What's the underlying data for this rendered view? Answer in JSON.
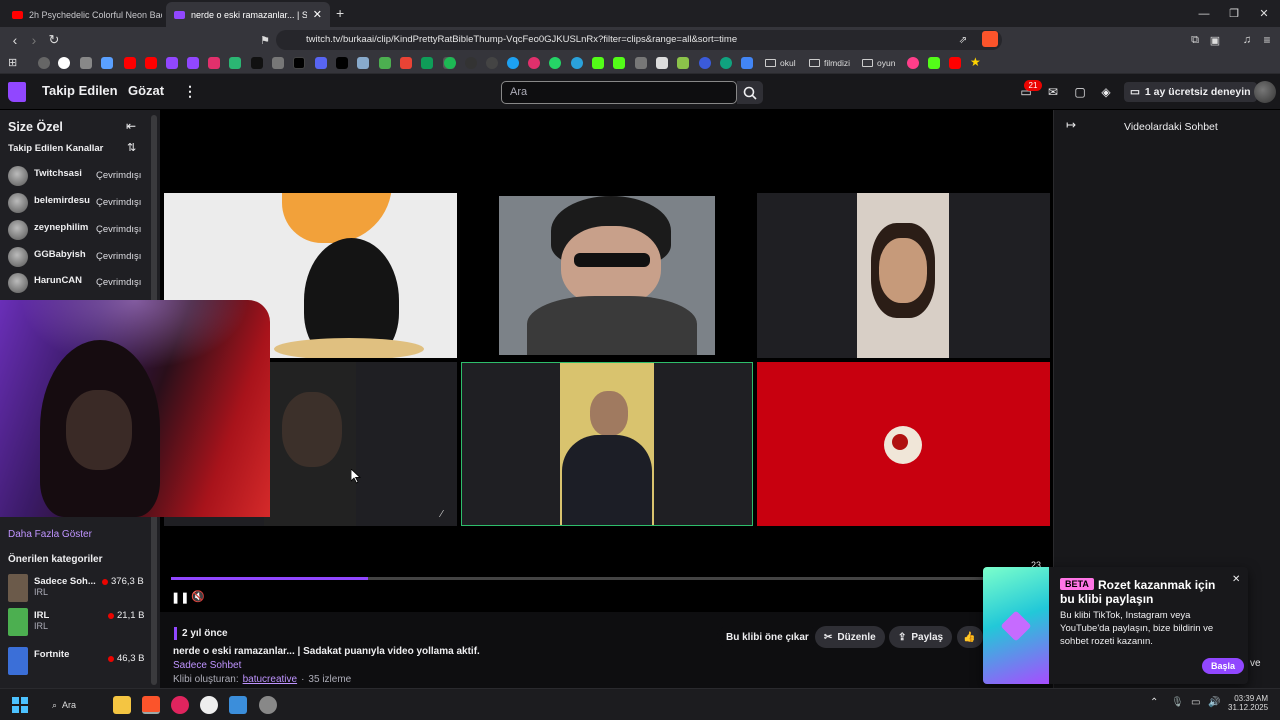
{
  "browser": {
    "tabs": [
      {
        "label": "2h Psychedelic Colorful Neon Backgr",
        "active": false
      },
      {
        "label": "nerde o eski ramazanlar... | Sadakat",
        "active": true
      }
    ],
    "url": "twitch.tv/burkaai/clip/KindPrettyRatBibleThump-VqcFeo0GJKUSLnRx?filter=clips&range=all&sort=time",
    "bookmark_folders": [
      "okul",
      "filmdizi",
      "oyun"
    ]
  },
  "nav": {
    "following": "Takip Edilen",
    "browse": "Gözat",
    "search_placeholder": "Ara",
    "notif_count": "21",
    "promo": "1 ay ücretsiz deneyin"
  },
  "sidebar": {
    "title": "Size Özel",
    "followed_title": "Takip Edilen Kanallar",
    "channels": [
      {
        "name": "Twitchsasi",
        "status": "Çevrimdışı"
      },
      {
        "name": "belemirdesu",
        "status": "Çevrimdışı"
      },
      {
        "name": "zeynephilim",
        "status": "Çevrimdışı"
      },
      {
        "name": "GGBabyish",
        "status": "Çevrimdışı"
      },
      {
        "name": "HarunCAN",
        "status": "Çevrimdışı"
      }
    ],
    "show_more": "Daha Fazla Göster",
    "recommended_title": "Önerilen kategoriler",
    "categories": [
      {
        "name": "Sadece Soh...",
        "sub": "IRL",
        "viewers": "376,3 B",
        "color": "#6b5a4a"
      },
      {
        "name": "IRL",
        "sub": "IRL",
        "viewers": "21,1 B",
        "color": "#4caf50"
      },
      {
        "name": "Fortnite",
        "sub": "",
        "viewers": "46,3 B",
        "color": "#3b6fd8"
      }
    ]
  },
  "player": {
    "progress": 0.243,
    "time_remaining": "23"
  },
  "clip": {
    "age": "2 yıl önce",
    "title": "nerde o eski ramazanlar... | Sadakat puanıyla video yollama aktif.",
    "category": "Sadece Sohbet",
    "creator_prefix": "Klibi oluşturan:",
    "creator": "batucreative",
    "views": "35 izleme",
    "feature_btn": "Bu klibi öne çıkar",
    "edit_btn": "Düzenle",
    "share_btn": "Paylaş"
  },
  "chat": {
    "title": "Videolardaki Sohbet"
  },
  "popup": {
    "beta": "BETA",
    "title": "Rozet kazanmak için bu klibi paylaşın",
    "body": "Bu klibi TikTok, Instagram veya YouTube'da paylaşın, bize bildirin ve sohbet rozeti kazanın.",
    "button": "Başla",
    "edge_text": "ve"
  },
  "taskbar": {
    "search": "Ara",
    "time": "03:39 AM",
    "date": "31.12.2025"
  }
}
